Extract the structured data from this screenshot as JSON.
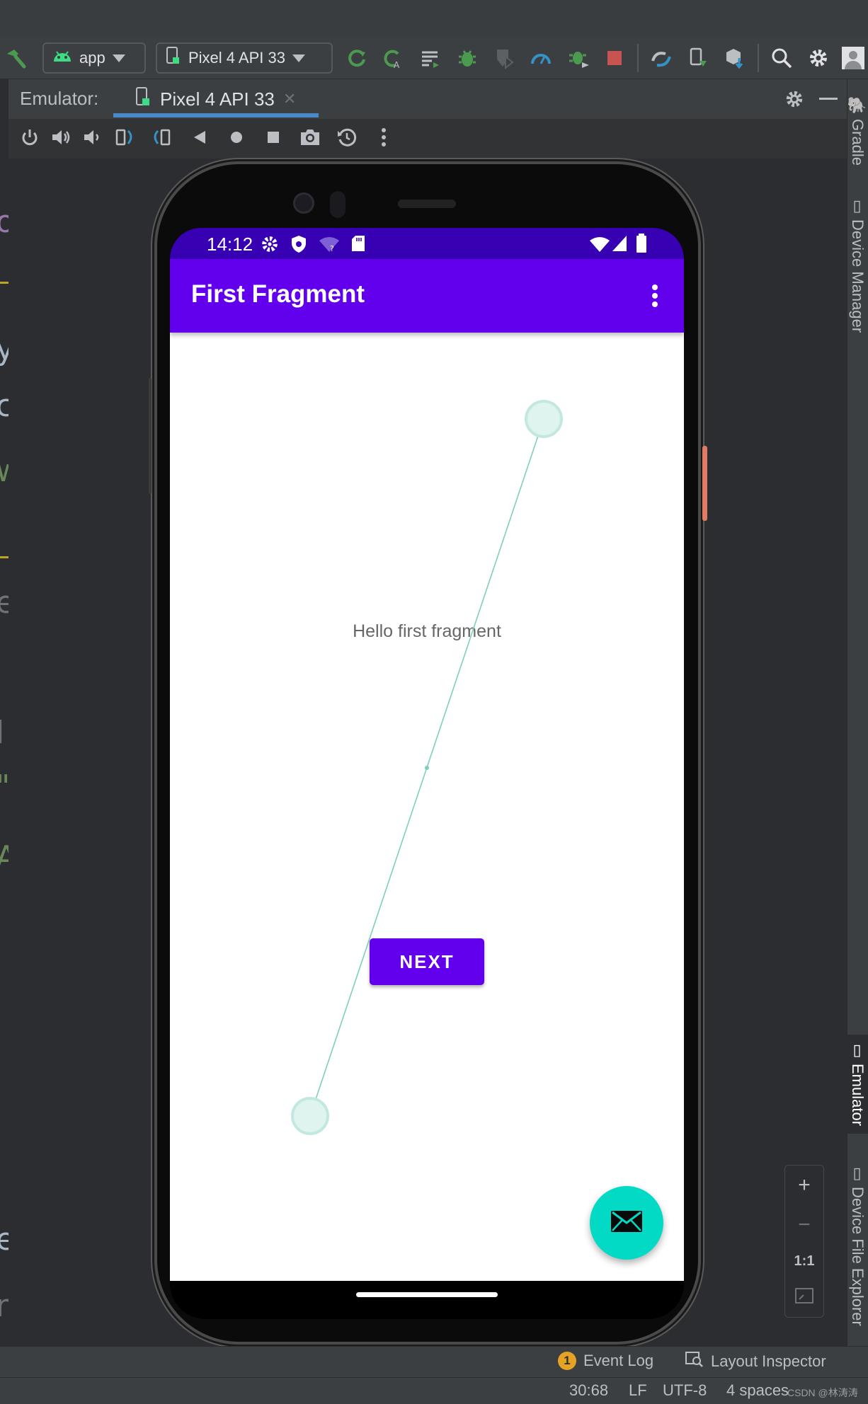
{
  "toolbar": {
    "config_label": "app",
    "device_label": "Pixel 4 API 33",
    "icons": [
      "hammer-icon",
      "android-icon",
      "device-icon",
      "rerun-icon",
      "apply-changes-icon",
      "attach-icon",
      "debug-icon",
      "coverage-icon",
      "profile-icon",
      "attach-debugger-icon",
      "stop-icon",
      "sync-icon",
      "device-manager-icon",
      "sdk-manager-icon",
      "search-icon",
      "settings-icon",
      "avatar"
    ]
  },
  "emulator_panel": {
    "label": "Emulator:",
    "tab_label": "Pixel 4 API 33",
    "controls": [
      "power-icon",
      "volume-up-icon",
      "volume-down-icon",
      "rotate-left-icon",
      "rotate-right-icon",
      "back-icon",
      "home-icon",
      "overview-icon",
      "screenshot-icon",
      "snapshot-icon",
      "more-icon"
    ]
  },
  "right_stripe": {
    "gradle": "Gradle",
    "device_manager": "Device Manager",
    "emulator": "Emulator",
    "device_file_explorer": "Device File Explorer"
  },
  "gutter_glyphs": [
    "o",
    "y",
    "c",
    "w",
    "e",
    "l",
    "\"",
    "A",
    "e",
    "r"
  ],
  "phone": {
    "status": {
      "time": "14:12",
      "left_icons": [
        "settings-icon",
        "shield-icon",
        "wifi-question-icon",
        "sd-card-icon"
      ],
      "right_icons": [
        "wifi-icon",
        "signal-icon",
        "battery-icon"
      ]
    },
    "app_bar_title": "First Fragment",
    "body_text": "Hello first fragment",
    "next_button": "NEXT",
    "fab_icon": "email-icon",
    "colors": {
      "primary": "#6200ee",
      "primary_dark": "#3700b3",
      "accent": "#03dac5"
    }
  },
  "zoom": {
    "plus": "+",
    "minus": "−",
    "actual": "1:1",
    "fit": "fit-screen-icon"
  },
  "bottom_tools": {
    "event_count": "1",
    "event_log": "Event Log",
    "layout_inspector": "Layout Inspector"
  },
  "status_line": {
    "position": "30:68",
    "line_sep": "LF",
    "encoding": "UTF-8",
    "indent": "4 spaces",
    "watermark": "CSDN @林涛涛"
  }
}
